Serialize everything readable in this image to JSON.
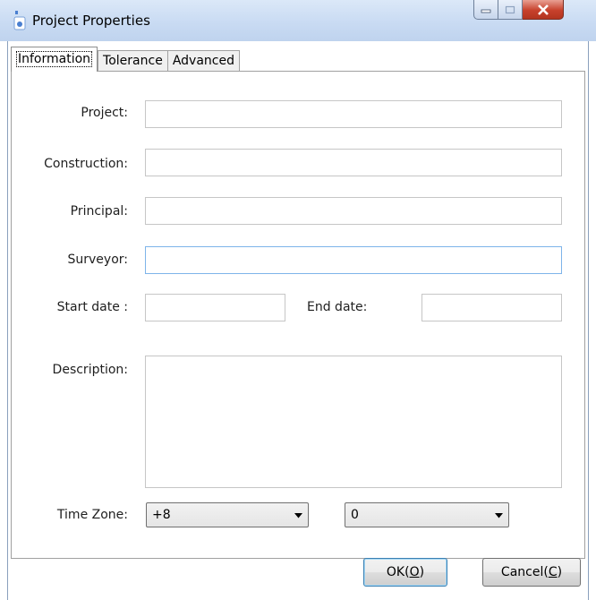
{
  "window": {
    "title": "Project Properties",
    "icon": "project-icon"
  },
  "tabs": [
    {
      "label": "Information",
      "active": true
    },
    {
      "label": "Tolerance",
      "active": false
    },
    {
      "label": "Advanced",
      "active": false
    }
  ],
  "form": {
    "project_label": "Project:",
    "project_value": "",
    "construction_label": "Construction:",
    "construction_value": "",
    "principal_label": "Principal:",
    "principal_value": "",
    "surveyor_label": "Surveyor:",
    "surveyor_value": "",
    "start_date_label": "Start date :",
    "start_date_value": "",
    "end_date_label": "End date:",
    "end_date_value": "",
    "description_label": "Description:",
    "description_value": "",
    "timezone_label": "Time Zone:",
    "timezone_hours": "+8",
    "timezone_minutes": "0"
  },
  "buttons": {
    "ok_text": "OK(",
    "ok_mnemonic": "O",
    "ok_tail": ")",
    "cancel_text": "Cancel(",
    "cancel_mnemonic": "C",
    "cancel_tail": ")"
  },
  "colors": {
    "titlebar": "#c9dbf3",
    "close_button": "#c7412c",
    "focus_border": "#7eb4ea"
  }
}
